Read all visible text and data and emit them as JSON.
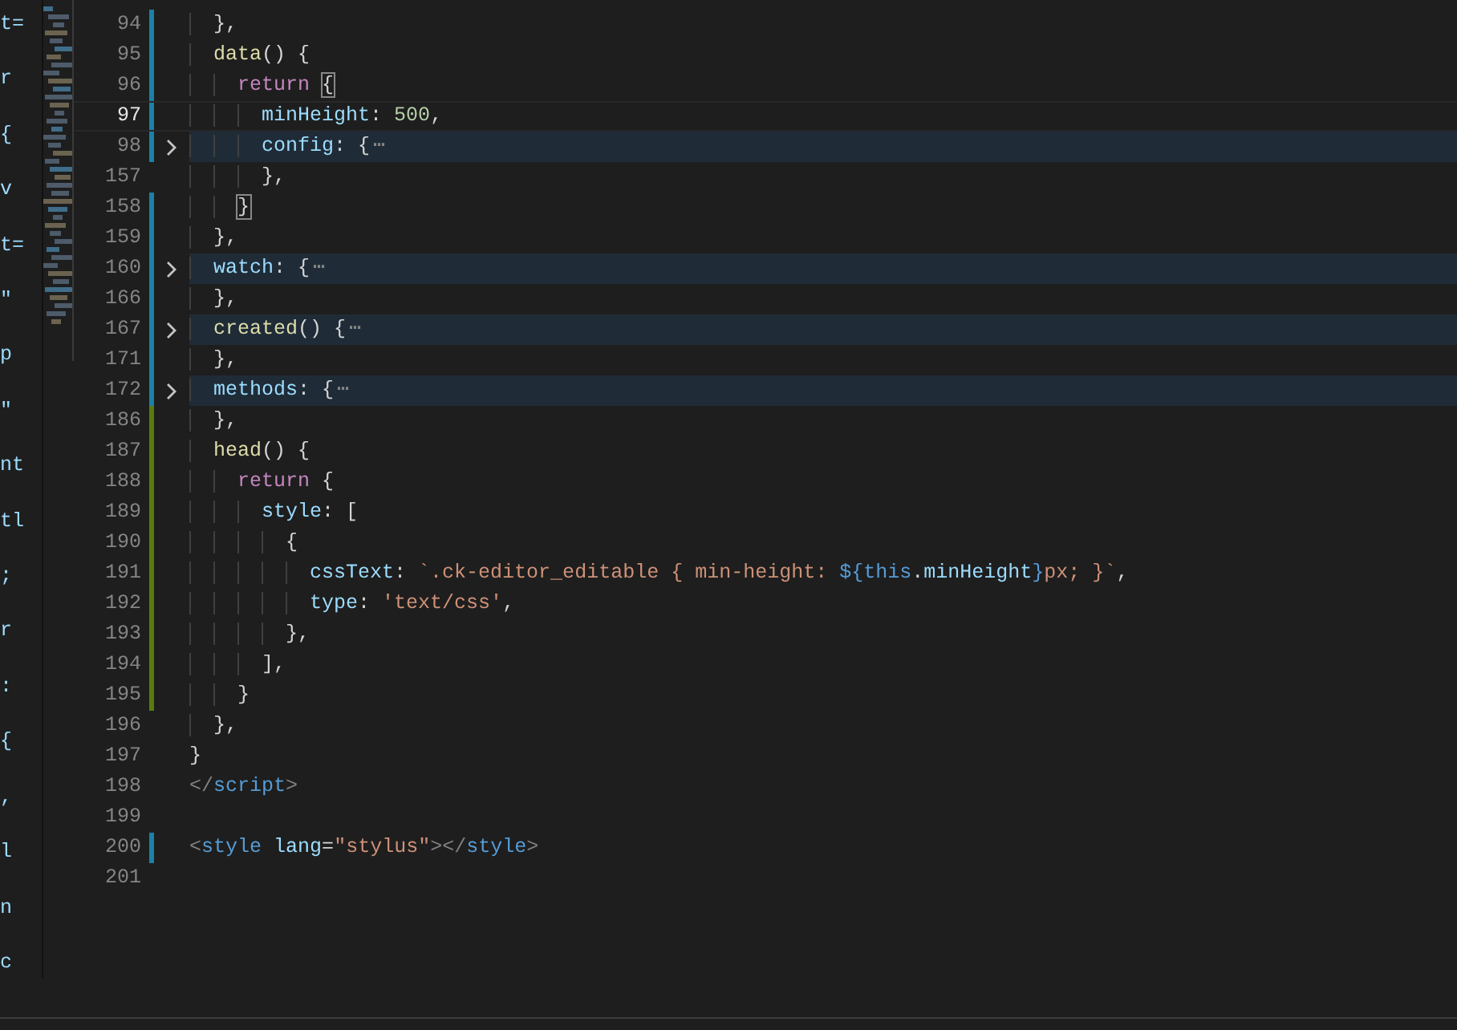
{
  "side_pane": {
    "lines": [
      "t=",
      "r",
      "{",
      "v",
      "t=",
      "\"",
      "p",
      "\"",
      "nt",
      "tl",
      ";",
      "r",
      ":",
      "{",
      ",",
      "l",
      "n",
      "c"
    ]
  },
  "editor": {
    "lines": [
      {
        "number": "94",
        "color": "#1b81a8",
        "folded": false,
        "current": false,
        "tokens": [
          {
            "t": "  },",
            "kind": "punct"
          }
        ]
      },
      {
        "number": "95",
        "color": "#1b81a8",
        "folded": false,
        "current": false,
        "tokens": [
          {
            "t": "  data",
            "kind": "fn"
          },
          {
            "t": "() {",
            "kind": "punct"
          }
        ]
      },
      {
        "number": "96",
        "color": "#1b81a8",
        "folded": false,
        "current": false,
        "tokens": [
          {
            "t": "    return ",
            "kind": "kw"
          },
          {
            "t": "{",
            "kind": "bracket"
          }
        ]
      },
      {
        "number": "97",
        "color": "#1b81a8",
        "folded": false,
        "current": true,
        "tokens": [
          {
            "t": "      minHeight",
            "kind": "prop"
          },
          {
            "t": ": ",
            "kind": "punct"
          },
          {
            "t": "500",
            "kind": "num"
          },
          {
            "t": ",",
            "kind": "punct"
          }
        ]
      },
      {
        "number": "98",
        "color": "#1b81a8",
        "folded": true,
        "current": false,
        "tokens": [
          {
            "t": "      config",
            "kind": "prop"
          },
          {
            "t": ": {",
            "kind": "punct"
          },
          {
            "t": "⋯",
            "kind": "ellipsis"
          }
        ]
      },
      {
        "number": "157",
        "folded": false,
        "current": false,
        "tokens": [
          {
            "t": "      },",
            "kind": "punct"
          }
        ]
      },
      {
        "number": "158",
        "color": "#1b81a8",
        "folded": false,
        "current": false,
        "tokens": [
          {
            "t": "    }",
            "kind": "bracket"
          }
        ]
      },
      {
        "number": "159",
        "color": "#1b81a8",
        "folded": false,
        "current": false,
        "tokens": [
          {
            "t": "  },",
            "kind": "punct"
          }
        ]
      },
      {
        "number": "160",
        "color": "#1b81a8",
        "folded": true,
        "current": false,
        "tokens": [
          {
            "t": "  watch",
            "kind": "prop"
          },
          {
            "t": ": {",
            "kind": "punct"
          },
          {
            "t": "⋯",
            "kind": "ellipsis"
          }
        ]
      },
      {
        "number": "166",
        "color": "#1b81a8",
        "folded": false,
        "current": false,
        "tokens": [
          {
            "t": "  },",
            "kind": "punct"
          }
        ]
      },
      {
        "number": "167",
        "color": "#1b81a8",
        "folded": true,
        "current": false,
        "tokens": [
          {
            "t": "  created",
            "kind": "fn"
          },
          {
            "t": "() {",
            "kind": "punct"
          },
          {
            "t": "⋯",
            "kind": "ellipsis"
          }
        ]
      },
      {
        "number": "171",
        "color": "#1b81a8",
        "folded": false,
        "current": false,
        "tokens": [
          {
            "t": "  },",
            "kind": "punct"
          }
        ]
      },
      {
        "number": "172",
        "color": "#1b81a8",
        "folded": true,
        "current": false,
        "tokens": [
          {
            "t": "  methods",
            "kind": "prop"
          },
          {
            "t": ": {",
            "kind": "punct"
          },
          {
            "t": "⋯",
            "kind": "ellipsis"
          }
        ]
      },
      {
        "number": "186",
        "color": "#587c0c",
        "folded": false,
        "current": false,
        "tokens": [
          {
            "t": "  },",
            "kind": "punct"
          }
        ]
      },
      {
        "number": "187",
        "color": "#587c0c",
        "folded": false,
        "current": false,
        "tokens": [
          {
            "t": "  head",
            "kind": "fn"
          },
          {
            "t": "() {",
            "kind": "punct"
          }
        ]
      },
      {
        "number": "188",
        "color": "#587c0c",
        "folded": false,
        "current": false,
        "tokens": [
          {
            "t": "    return",
            "kind": "kw"
          },
          {
            "t": " {",
            "kind": "punct"
          }
        ]
      },
      {
        "number": "189",
        "color": "#587c0c",
        "folded": false,
        "current": false,
        "tokens": [
          {
            "t": "      style",
            "kind": "prop"
          },
          {
            "t": ": [",
            "kind": "punct"
          }
        ]
      },
      {
        "number": "190",
        "color": "#587c0c",
        "folded": false,
        "current": false,
        "tokens": [
          {
            "t": "        {",
            "kind": "punct"
          }
        ]
      },
      {
        "number": "191",
        "color": "#587c0c",
        "folded": false,
        "current": false,
        "tokens": [
          {
            "t": "          cssText",
            "kind": "prop"
          },
          {
            "t": ": ",
            "kind": "punct"
          },
          {
            "t": "`.ck-editor_editable { min-height: ",
            "kind": "str"
          },
          {
            "t": "${",
            "kind": "tag"
          },
          {
            "t": "this",
            "kind": "tag"
          },
          {
            "t": ".",
            "kind": "punct"
          },
          {
            "t": "minHeight",
            "kind": "prop"
          },
          {
            "t": "}",
            "kind": "tag"
          },
          {
            "t": "px; }`",
            "kind": "str"
          },
          {
            "t": ",",
            "kind": "punct"
          }
        ]
      },
      {
        "number": "192",
        "color": "#587c0c",
        "folded": false,
        "current": false,
        "tokens": [
          {
            "t": "          type",
            "kind": "prop"
          },
          {
            "t": ": ",
            "kind": "punct"
          },
          {
            "t": "'text/css'",
            "kind": "str"
          },
          {
            "t": ",",
            "kind": "punct"
          }
        ]
      },
      {
        "number": "193",
        "color": "#587c0c",
        "folded": false,
        "current": false,
        "tokens": [
          {
            "t": "        },",
            "kind": "punct"
          }
        ]
      },
      {
        "number": "194",
        "color": "#587c0c",
        "folded": false,
        "current": false,
        "tokens": [
          {
            "t": "      ],",
            "kind": "punct"
          }
        ]
      },
      {
        "number": "195",
        "color": "#587c0c",
        "folded": false,
        "current": false,
        "tokens": [
          {
            "t": "    }",
            "kind": "punct"
          }
        ]
      },
      {
        "number": "196",
        "folded": false,
        "current": false,
        "tokens": [
          {
            "t": "  },",
            "kind": "punct"
          }
        ]
      },
      {
        "number": "197",
        "folded": false,
        "current": false,
        "tokens": [
          {
            "t": "}",
            "kind": "punct"
          }
        ]
      },
      {
        "number": "198",
        "folded": false,
        "current": false,
        "tokens": [
          {
            "t": "</",
            "kind": "angle"
          },
          {
            "t": "script",
            "kind": "tag"
          },
          {
            "t": ">",
            "kind": "angle"
          }
        ]
      },
      {
        "number": "199",
        "current": false
      },
      {
        "number": "200",
        "color": "#1b81a8",
        "folded": false,
        "current": false,
        "tokens": [
          {
            "t": "<",
            "kind": "angle"
          },
          {
            "t": "style",
            "kind": "tag"
          },
          {
            "t": " lang",
            "kind": "prop"
          },
          {
            "t": "=",
            "kind": "punct"
          },
          {
            "t": "\"stylus\"",
            "kind": "str"
          },
          {
            "t": "></",
            "kind": "angle"
          },
          {
            "t": "style",
            "kind": "tag"
          },
          {
            "t": ">",
            "kind": "angle"
          }
        ]
      },
      {
        "number": "201",
        "current": false
      }
    ]
  }
}
